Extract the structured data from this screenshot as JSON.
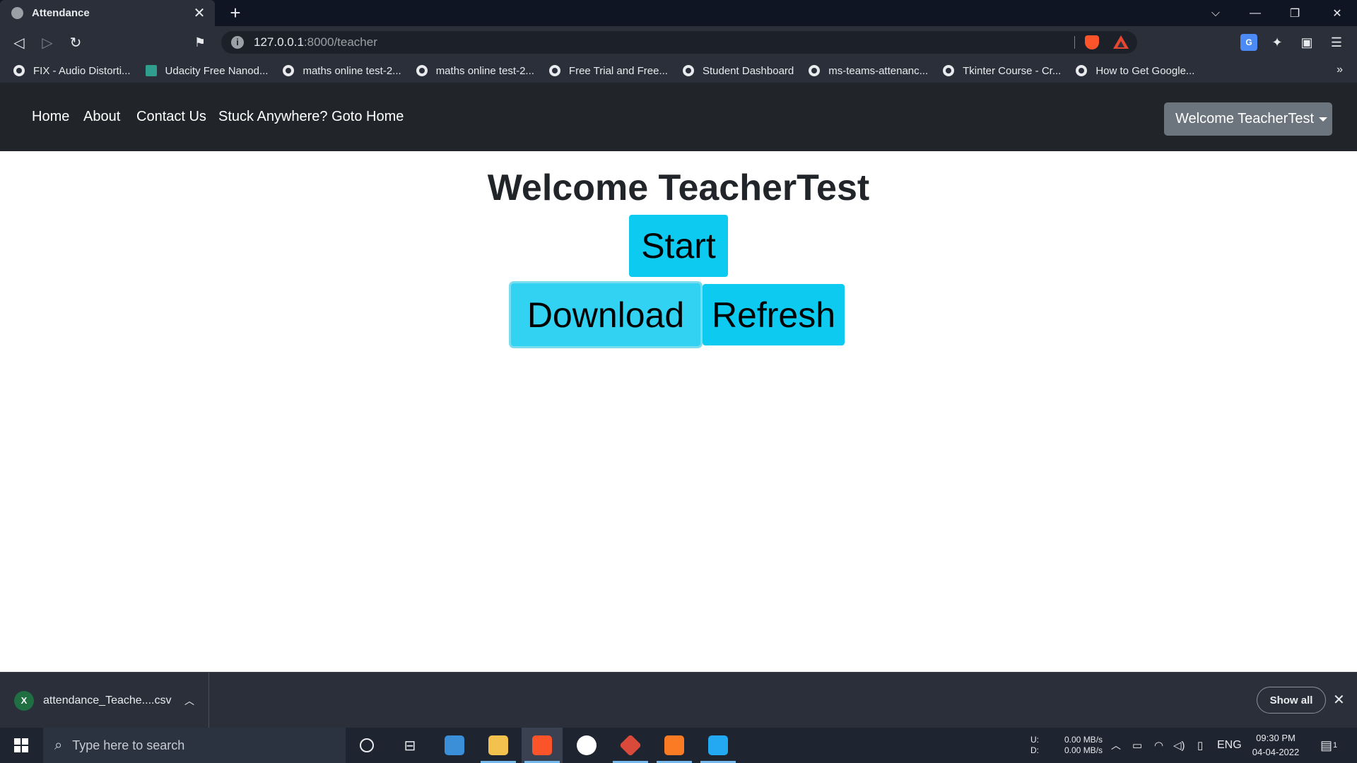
{
  "browser": {
    "tab_title": "Attendance",
    "tab_close": "✕",
    "new_tab": "+",
    "url_host": "127.0.0.1",
    "url_path": ":8000/teacher",
    "window_controls": [
      "⌵",
      "—",
      "❐",
      "✕"
    ]
  },
  "bookmarks": [
    {
      "label": "FIX - Audio Distorti...",
      "icon": "globe"
    },
    {
      "label": "Udacity Free Nanod...",
      "icon": "udacity"
    },
    {
      "label": "maths online test-2...",
      "icon": "globe"
    },
    {
      "label": "maths online test-2...",
      "icon": "globe"
    },
    {
      "label": "Free Trial and Free...",
      "icon": "globe"
    },
    {
      "label": "Student Dashboard",
      "icon": "globe"
    },
    {
      "label": "ms-teams-attenanc...",
      "icon": "github"
    },
    {
      "label": "Tkinter Course - Cr...",
      "icon": "globe"
    },
    {
      "label": "How to Get Google...",
      "icon": "globe"
    }
  ],
  "bookmarks_more": "»",
  "navbar": {
    "links": [
      "Home",
      "About",
      "Contact Us",
      "Stuck Anywhere? Goto Home"
    ],
    "user_dropdown": "Welcome TeacherTest"
  },
  "main": {
    "heading": "Welcome TeacherTest",
    "start_label": "Start",
    "download_label": "Download",
    "refresh_label": "Refresh"
  },
  "downloads_bar": {
    "file_name": "attendance_Teache....csv",
    "show_all": "Show all"
  },
  "taskbar": {
    "search_placeholder": "Type here to search",
    "net_labels": [
      "U:",
      "D:"
    ],
    "net_rates": [
      "0.00 MB/s",
      "0.00 MB/s"
    ],
    "language": "ENG",
    "time": "09:30 PM",
    "date": "04-04-2022",
    "notification_count": "1"
  },
  "colors": {
    "navbar_bg": "#212529",
    "button_info": "#0dcaf0",
    "dropdown_bg": "#6c757d"
  }
}
